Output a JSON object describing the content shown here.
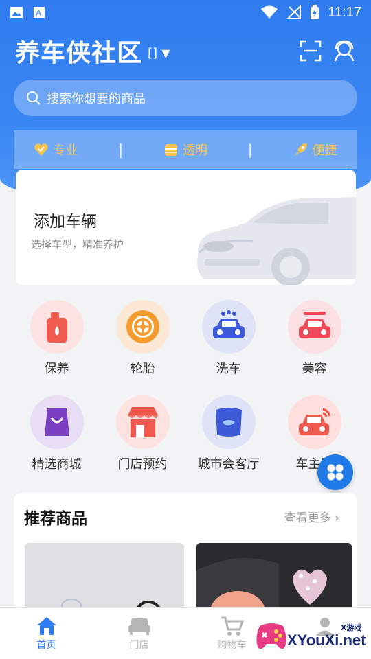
{
  "status_bar": {
    "time": "11:17"
  },
  "header": {
    "title": "养车侠社区",
    "title_suffix": "[]",
    "dropdown_icon": "caret-down-icon"
  },
  "search": {
    "placeholder": "搜索你想要的商品"
  },
  "features": [
    {
      "label": "专业",
      "icon": "heart-badge-icon"
    },
    {
      "label": "透明",
      "icon": "coin-icon"
    },
    {
      "label": "便捷",
      "icon": "rocket-icon"
    }
  ],
  "features_divider": "|",
  "vehicle_card": {
    "title": "添加车辆",
    "subtitle": "选择车型，精准养护"
  },
  "services_row1": [
    {
      "label": "保养",
      "icon": "oil-can-icon"
    },
    {
      "label": "轮胎",
      "icon": "tire-icon"
    },
    {
      "label": "洗车",
      "icon": "car-wash-icon"
    },
    {
      "label": "美容",
      "icon": "car-beauty-icon"
    }
  ],
  "services_row2": [
    {
      "label": "精选商城",
      "icon": "shopping-bag-icon"
    },
    {
      "label": "门店预约",
      "icon": "store-icon"
    },
    {
      "label": "城市会客厅",
      "icon": "sofa-icon"
    },
    {
      "label": "车主服",
      "icon": "car-signal-icon"
    }
  ],
  "recommend": {
    "title": "推荐商品",
    "more": "查看更多"
  },
  "tabbar": [
    {
      "label": "首页",
      "icon": "home-icon",
      "active": true
    },
    {
      "label": "门店",
      "icon": "sofa-tab-icon",
      "active": false
    },
    {
      "label": "购物车",
      "icon": "cart-icon",
      "active": false
    },
    {
      "label": "",
      "icon": "profile-icon",
      "active": false
    }
  ],
  "watermark": {
    "text": "XYouXi.net",
    "small": "X游戏"
  },
  "colors": {
    "primary": "#2f7cf0",
    "accent_gold": "#f7c54c",
    "fab": "#1f7ae8"
  }
}
